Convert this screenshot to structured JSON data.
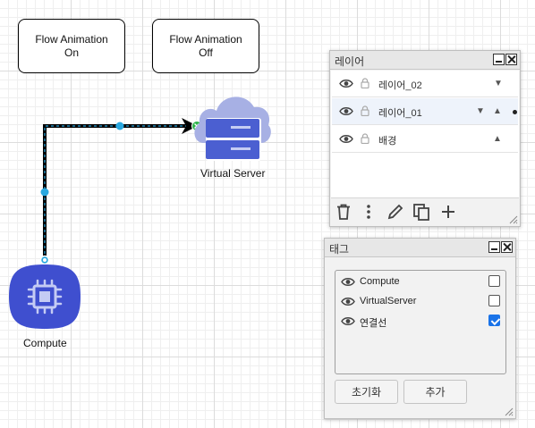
{
  "canvas": {
    "flow_animation_on": "Flow Animation\nOn",
    "flow_animation_off": "Flow Animation\nOff",
    "virtual_server_label": "Virtual Server",
    "compute_label": "Compute",
    "colors": {
      "connector": "#000000",
      "handle": "#29a8e0",
      "target_handle": "#2cb34a",
      "cloud": "#a7b0e4",
      "server": "#4b5fd1",
      "compute_bg": "#3f4fcf"
    }
  },
  "layers_panel": {
    "title": "레이어",
    "layers": [
      {
        "name": "레이어_02",
        "selected": false
      },
      {
        "name": "레이어_01",
        "selected": true
      },
      {
        "name": "배경",
        "selected": false
      }
    ],
    "toolbar_icons": [
      "trash-icon",
      "more-vertical-icon",
      "pencil-icon",
      "duplicate-icon",
      "plus-icon"
    ]
  },
  "tags_panel": {
    "title": "태그",
    "tags": [
      {
        "name": "Compute",
        "checked": false
      },
      {
        "name": "VirtualServer",
        "checked": false
      },
      {
        "name": "연결선",
        "checked": true
      }
    ],
    "reset_label": "초기화",
    "add_label": "추가"
  }
}
